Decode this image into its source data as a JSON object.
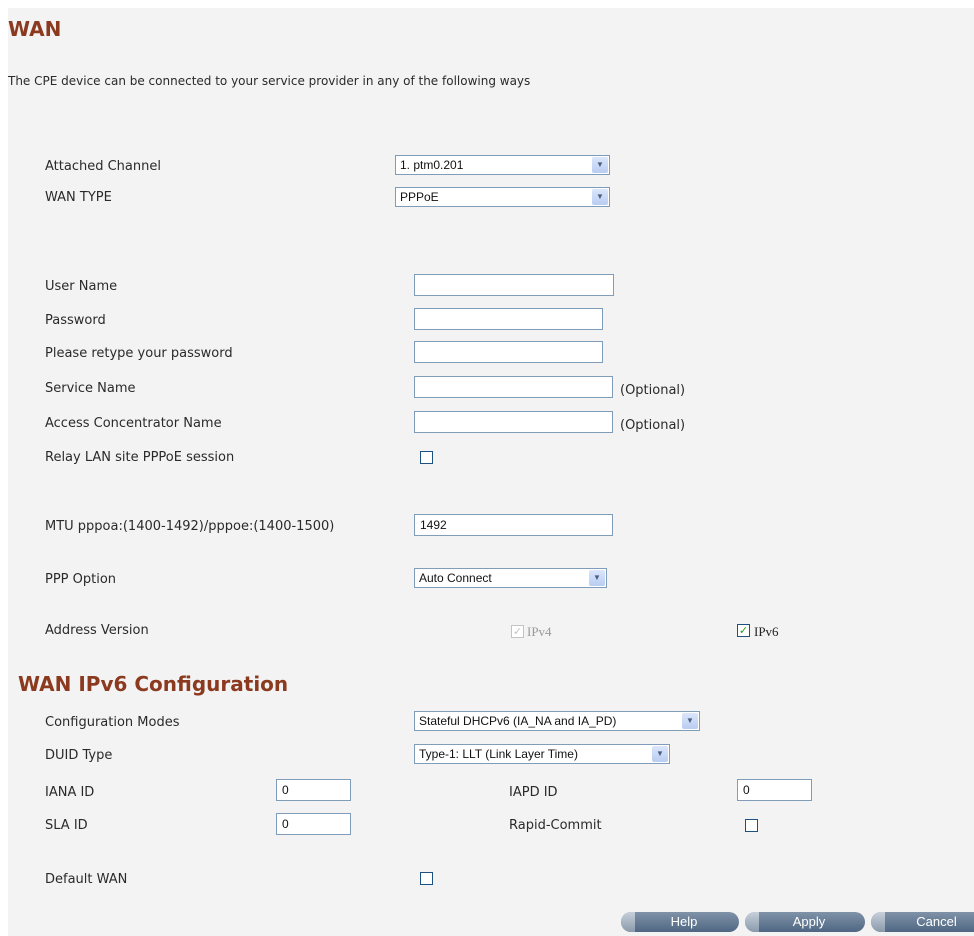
{
  "page": {
    "title": "WAN",
    "description": "The CPE device can be connected to your service provider in any of the following ways"
  },
  "channel": {
    "attached_channel_label": "Attached Channel",
    "attached_channel_value": "1. ptm0.201",
    "wan_type_label": "WAN TYPE",
    "wan_type_value": "PPPoE"
  },
  "pppoe": {
    "username_label": "User Name",
    "username_value": "",
    "password_label": "Password",
    "password_value": "",
    "retype_label": "Please retype your password",
    "retype_value": "",
    "service_name_label": "Service Name",
    "service_name_value": "",
    "service_name_hint": "(Optional)",
    "ac_name_label": "Access Concentrator Name",
    "ac_name_value": "",
    "ac_name_hint": "(Optional)",
    "relay_label": "Relay LAN site PPPoE session",
    "relay_checked": false,
    "mtu_label": "MTU pppoa:(1400-1492)/pppoe:(1400-1500)",
    "mtu_value": "1492",
    "ppp_option_label": "PPP Option",
    "ppp_option_value": "Auto Connect",
    "address_version_label": "Address Version",
    "ipv4_label": "IPv4",
    "ipv4_checked": true,
    "ipv4_disabled": true,
    "ipv6_label": "IPv6",
    "ipv6_checked": true
  },
  "ipv6": {
    "section_title": "WAN IPv6 Configuration",
    "config_modes_label": "Configuration Modes",
    "config_modes_value": "Stateful DHCPv6 (IA_NA and IA_PD)",
    "duid_type_label": "DUID Type",
    "duid_type_value": "Type-1: LLT (Link Layer Time)",
    "iana_id_label": "IANA ID",
    "iana_id_value": "0",
    "iapd_id_label": "IAPD ID",
    "iapd_id_value": "0",
    "sla_id_label": "SLA ID",
    "sla_id_value": "0",
    "rapid_commit_label": "Rapid-Commit",
    "rapid_commit_checked": false
  },
  "default_wan": {
    "label": "Default WAN",
    "checked": false
  },
  "buttons": {
    "help": "Help",
    "apply": "Apply",
    "cancel": "Cancel"
  },
  "icons": {
    "dropdown": "chevron-down-icon",
    "checkmark": "checkmark-icon"
  },
  "colors": {
    "title": "#8b3a1f",
    "panel_background": "#f3f3f3",
    "button": "#5b708c",
    "checkmark": "#21a121"
  }
}
